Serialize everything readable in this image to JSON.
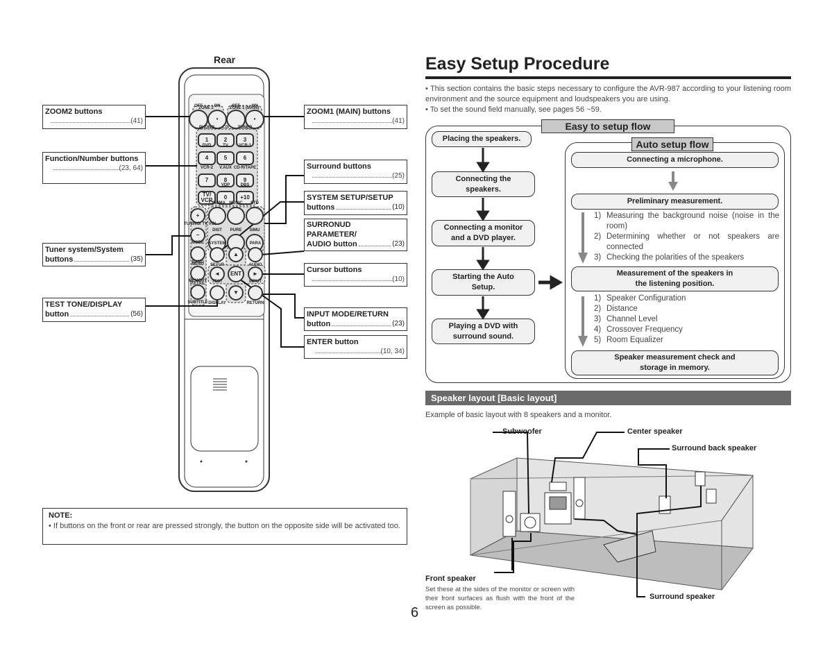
{
  "remote": {
    "rear_label": "Rear",
    "groups": {
      "zone2": "ZONE 2",
      "zone1": "ZONE 1 (MAIN)"
    },
    "buttons": [
      {
        "top": "OFF",
        "text": ""
      },
      {
        "top": "ON",
        "text": "•"
      },
      {
        "top": "OFF",
        "text": ""
      },
      {
        "top": "ON",
        "text": "•"
      },
      {
        "top": "PHONO",
        "text": "1"
      },
      {
        "top": "CD",
        "text": "2"
      },
      {
        "top": "TUNER",
        "text": "3"
      },
      {
        "top": "DVD",
        "text": "4"
      },
      {
        "top": "TV",
        "text": "5"
      },
      {
        "top": "VCR-1",
        "text": "6"
      },
      {
        "top": "VCR-2",
        "text": "7"
      },
      {
        "top": "V.AUX",
        "text": "8"
      },
      {
        "top": "CD-R/TAPE",
        "text": "9"
      },
      {
        "top": "",
        "text": "TV/ VCR"
      },
      {
        "top": "VDP",
        "text": "0"
      },
      {
        "top": "DBS",
        "text": "+10"
      },
      {
        "top": "CINEMA",
        "text": ""
      },
      {
        "top": "MUSIC",
        "text": ""
      },
      {
        "top": "STD",
        "text": ""
      },
      {
        "top": "DIST",
        "text": ""
      },
      {
        "top": "PURE",
        "text": ""
      },
      {
        "top": "SIMU",
        "text": ""
      },
      {
        "top": "",
        "text": "+"
      },
      {
        "top": "TUNING/ TV VOL",
        "text": "−"
      },
      {
        "top": "MODE",
        "bottom": "MENU",
        "text": ""
      },
      {
        "top": "BAND",
        "bottom": "P.ETAIL",
        "text": ""
      },
      {
        "top": "MEMORY",
        "bottom": "SUBTITLE",
        "text": ""
      },
      {
        "top": "SYSTEM",
        "bottom": "SETUP",
        "text": ""
      },
      {
        "top": "PARA",
        "bottom": "AUDIO",
        "text": ""
      },
      {
        "top": "",
        "text": "▲"
      },
      {
        "top": "",
        "text": "◄"
      },
      {
        "top": "",
        "text": "ENT"
      },
      {
        "top": "",
        "text": "►"
      },
      {
        "top": "",
        "text": "▼"
      },
      {
        "top": "TEST",
        "bottom": "DISPLAY",
        "text": ""
      },
      {
        "top": "INPUT",
        "bottom": "RETURN",
        "text": ""
      }
    ]
  },
  "callouts": {
    "left": [
      {
        "title": "ZOOM2 buttons",
        "ref": "(41)"
      },
      {
        "title": "Function/Number buttons",
        "ref": "(23, 64)"
      },
      {
        "title": "Tuner system/System",
        "title2": "buttons",
        "ref": "(35)"
      },
      {
        "title": "TEST TONE/DISPLAY",
        "title2": "button",
        "ref": "(56)"
      }
    ],
    "right": [
      {
        "title": "ZOOM1 (MAIN) buttons",
        "ref": "(41)"
      },
      {
        "title": "Surround buttons",
        "ref": "(25)"
      },
      {
        "title": "SYSTEM SETUP/SETUP",
        "title2": "buttons",
        "ref": "(10)"
      },
      {
        "title": "SURRONUD PARAMETER/",
        "title2": "AUDIO button",
        "ref": "(23)"
      },
      {
        "title": "Cursor buttons",
        "ref": "(10)"
      },
      {
        "title": "INPUT MODE/RETURN",
        "title2": "button",
        "ref": "(23)"
      },
      {
        "title": "ENTER button",
        "ref": "(10, 34)"
      }
    ]
  },
  "note": {
    "title": "NOTE:",
    "text": "• If buttons on the front or rear are pressed strongly, the button on the opposite side will be activated too."
  },
  "page_number": "6",
  "header": {
    "title": "Easy Setup Procedure"
  },
  "intro": [
    "• This section contains the basic steps necessary to configure the AVR-987 according to your listening room environment and the source equipment and loudspeakers you are using.",
    "• To set the sound field manually, see pages 56 ~59."
  ],
  "flow": {
    "title": "Easy to setup flow",
    "steps": [
      "Placing the speakers.",
      "Connecting the speakers.",
      "Connecting a monitor and a DVD player.",
      "Starting the Auto Setup.",
      "Playing a DVD with surround sound."
    ],
    "auto": {
      "title": "Auto setup flow",
      "mic": "Connecting a microphone.",
      "prelim": "Preliminary measurement.",
      "prelim_items": [
        [
          "1)",
          "Measuring the background noise (noise in the room)"
        ],
        [
          "2)",
          "Determining whether or not speakers are connected"
        ],
        [
          "3)",
          "Checking the polarities of the speakers"
        ]
      ],
      "measure": "Measurement of the speakers in the listening position.",
      "measure_items": [
        [
          "1)",
          "Speaker Configuration"
        ],
        [
          "2)",
          "Distance"
        ],
        [
          "3)",
          "Channel Level"
        ],
        [
          "4)",
          "Crossover Frequency"
        ],
        [
          "5)",
          "Room Equalizer"
        ]
      ],
      "check": "Speaker measurement check and storage in memory."
    }
  },
  "layout": {
    "section_title": "Speaker layout [Basic layout]",
    "example": "Example of basic layout with 8 speakers and a monitor.",
    "labels": {
      "subwoofer": "Subwoofer",
      "center": "Center speaker",
      "surround_back": "Surround back speaker",
      "front": "Front speaker",
      "surround": "Surround speaker"
    },
    "front_desc": "Set these at the sides of the monitor or screen with their front surfaces as flush with the front of the screen as possible."
  }
}
